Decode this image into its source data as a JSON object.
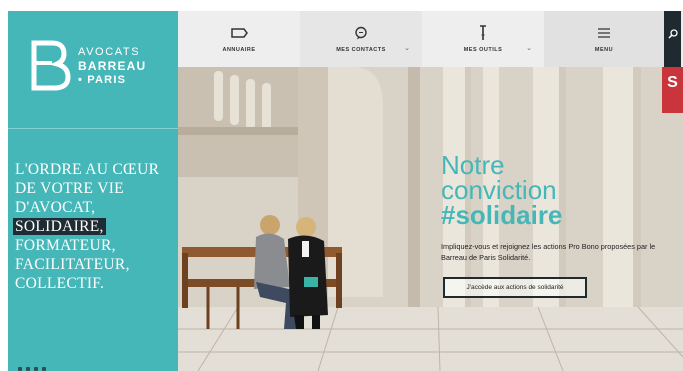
{
  "brand": {
    "line1": "AVOCATS",
    "line2": "BARREAU",
    "line3": "• PARIS"
  },
  "sidebar": {
    "tagline_before": "L'ORDRE AU CŒUR DE VOTRE VIE D'AVOCAT,",
    "tagline_highlight": "SOLIDAIRE,",
    "tagline_after": "FORMATEUR, FACILITATEUR, COLLECTIF."
  },
  "nav": {
    "items": [
      {
        "label": "ANNUAIRE",
        "icon": "directory-icon"
      },
      {
        "label": "MES CONTACTS",
        "icon": "chat-bubble-icon",
        "dropdown": true
      },
      {
        "label": "MES OUTILS",
        "icon": "tools-icon",
        "dropdown": true
      },
      {
        "label": "MENU",
        "icon": "hamburger-icon"
      }
    ],
    "search_icon": "search-icon"
  },
  "hero": {
    "title_line1": "Notre",
    "title_line2": "conviction",
    "title_line3": "#solidaire",
    "body": "Impliquez-vous et rejoignez les actions Pro Bono proposées par le Barreau de Paris Solidarité.",
    "cta": "J'accède aux actions de solidarité",
    "badge_letter": "S"
  },
  "colors": {
    "accent": "#45b7b8",
    "dark": "#1f2a30",
    "nav_bg": "#eeeeee",
    "badge": "#c9353a"
  }
}
